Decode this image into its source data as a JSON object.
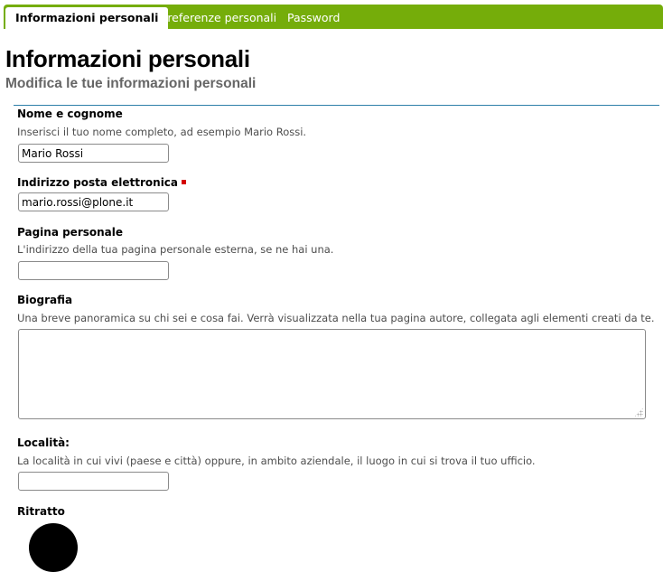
{
  "tabs": [
    {
      "label": "Informazioni personali",
      "active": true
    },
    {
      "label": "Preferenze personali",
      "active": false
    },
    {
      "label": "Password",
      "active": false
    }
  ],
  "page": {
    "title": "Informazioni personali",
    "subtitle": "Modifica le tue informazioni personali"
  },
  "form": {
    "fullname": {
      "label": "Nome e cognome",
      "help": "Inserisci il tuo nome completo, ad esempio Mario Rossi.",
      "value": "Mario Rossi"
    },
    "email": {
      "label": "Indirizzo posta elettronica",
      "required": true,
      "value": "mario.rossi@plone.it"
    },
    "homepage": {
      "label": "Pagina personale",
      "help": "L'indirizzo della tua pagina personale esterna, se ne hai una.",
      "value": ""
    },
    "biography": {
      "label": "Biografia",
      "help": "Una breve panoramica su chi sei e cosa fai. Verrà visualizzata nella tua pagina autore, collegata agli elementi creati da te.",
      "value": ""
    },
    "location": {
      "label": "Località:",
      "help": "La località in cui vivi (paese e città) oppure, in ambito aziendale, il luogo in cui si trova il tuo ufficio.",
      "value": ""
    },
    "portrait": {
      "label": "Ritratto"
    }
  },
  "colors": {
    "tabbar": "#75ad0a",
    "rule": "#2d7fa8",
    "required": "#d40000"
  }
}
